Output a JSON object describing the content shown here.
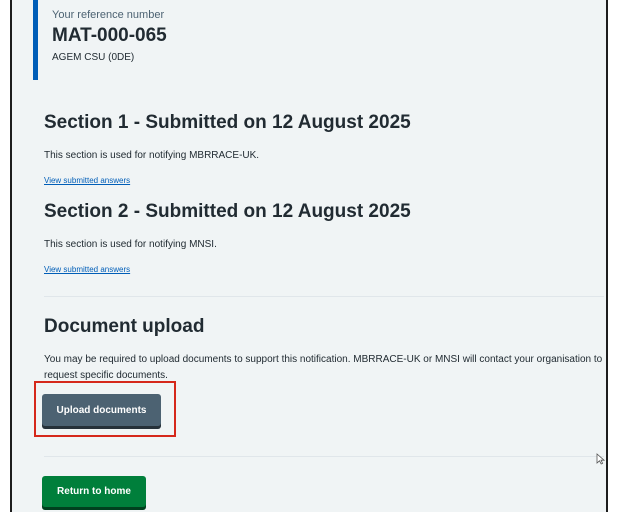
{
  "reference": {
    "caption": "Your reference number",
    "number": "MAT-000-065",
    "organisation": "AGEM CSU (0DE)"
  },
  "sections": [
    {
      "heading": "Section 1 - Submitted on 12 August 2025",
      "description": "This section is used for notifying MBRRACE-UK.",
      "link": "View submitted answers"
    },
    {
      "heading": "Section 2 - Submitted on 12 August 2025",
      "description": "This section is used for notifying MNSI.",
      "link": "View submitted answers"
    }
  ],
  "document_upload": {
    "heading": "Document upload",
    "description": "You may be required to upload documents to support this notification. MBRRACE-UK or MNSI will contact your organisation to request specific documents.",
    "button_label": "Upload documents"
  },
  "footer": {
    "return_label": "Return to home"
  },
  "colors": {
    "accent_blue": "#005eb8",
    "upload_button": "#4c6272",
    "home_button": "#007f3b",
    "highlight": "#d5281b"
  },
  "icons": [
    "mouse-cursor-icon"
  ]
}
